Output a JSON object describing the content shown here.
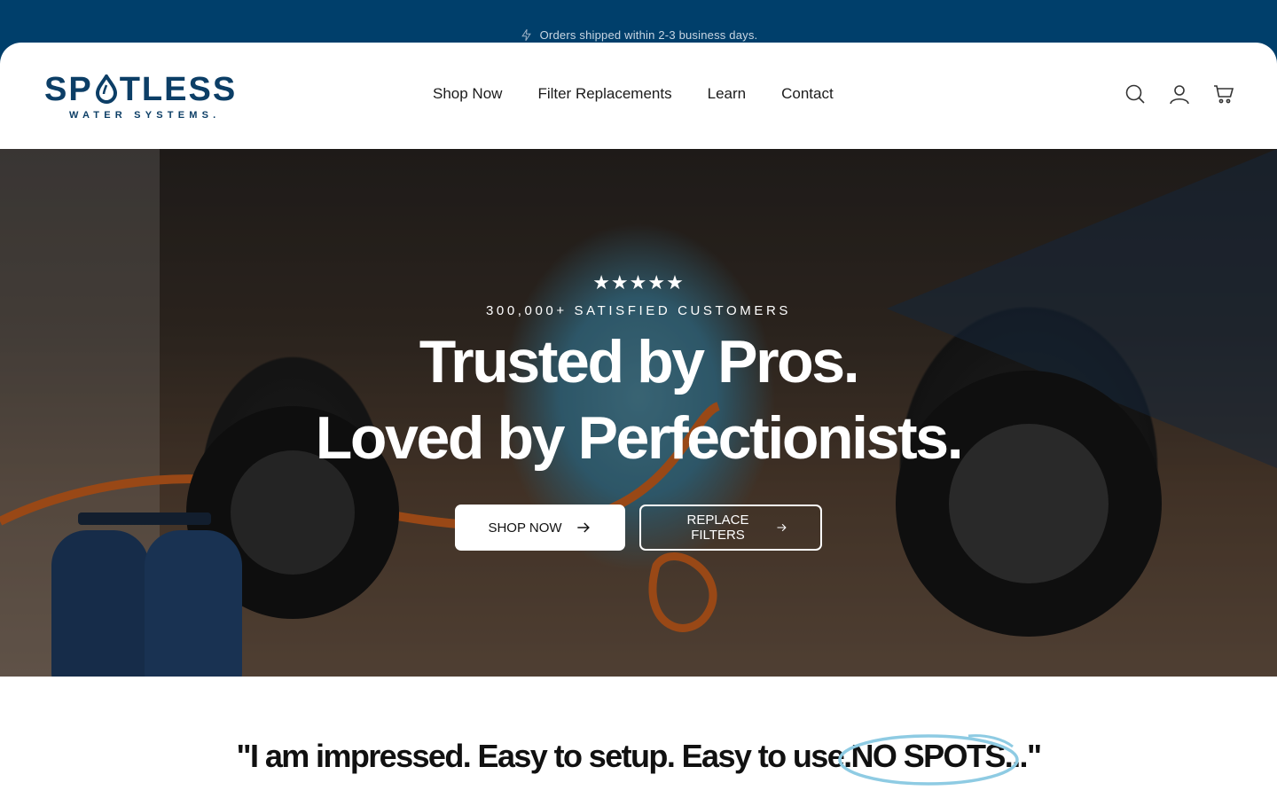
{
  "announcement": {
    "icon": "lightning-icon",
    "text": "Orders shipped within 2-3 business days."
  },
  "header": {
    "logo": {
      "main": "SPOTLESS",
      "sub": "WATER SYSTEMS."
    },
    "nav": [
      "Shop Now",
      "Filter Replacements",
      "Learn",
      "Contact"
    ],
    "icons": [
      "search-icon",
      "account-icon",
      "cart-icon"
    ]
  },
  "hero": {
    "stars": "★★★★★",
    "eyebrow": "300,000+ SATISFIED CUSTOMERS",
    "headline_1": "Trusted by Pros.",
    "headline_2": "Loved by Perfectionists.",
    "primary_button": "SHOP NOW",
    "secondary_button": "REPLACE FILTERS"
  },
  "testimonial": {
    "before": "\"I am impressed. Easy to setup. Easy to use.",
    "highlight": " NO SPOTS",
    "after": "...\""
  },
  "colors": {
    "announcement_bg": "#003f6b",
    "brand_navy": "#0c3e66",
    "highlight_ring": "#8ecbe3"
  }
}
